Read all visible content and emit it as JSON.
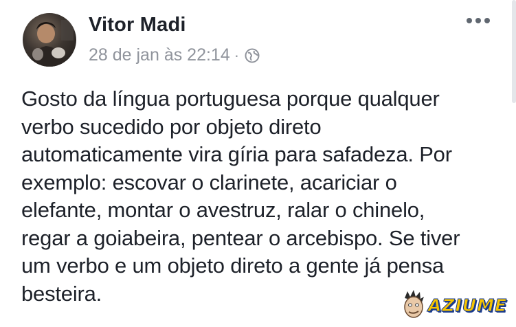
{
  "post": {
    "author": "Vitor Madi",
    "timestamp": "28 de jan às 22:14",
    "separator": "·",
    "privacy_icon": "globe-icon",
    "more_icon": "more-options-icon",
    "text_lines": [
      "Gosto da língua portuguesa porque qualquer",
      "verbo sucedido por objeto direto",
      "automaticamente vira gíria para safadeza. Por",
      "exemplo: escovar o clarinete, acariciar o",
      "elefante, montar o avestruz, ralar o chinelo,",
      "regar a goiabeira, pentear o arcebispo. Se tiver",
      "um verbo e um objeto direto a gente já pensa",
      "besteira."
    ]
  },
  "watermark": {
    "text": "AZIUME",
    "color": "#f5c400",
    "outline_color": "#1a3b8c"
  }
}
